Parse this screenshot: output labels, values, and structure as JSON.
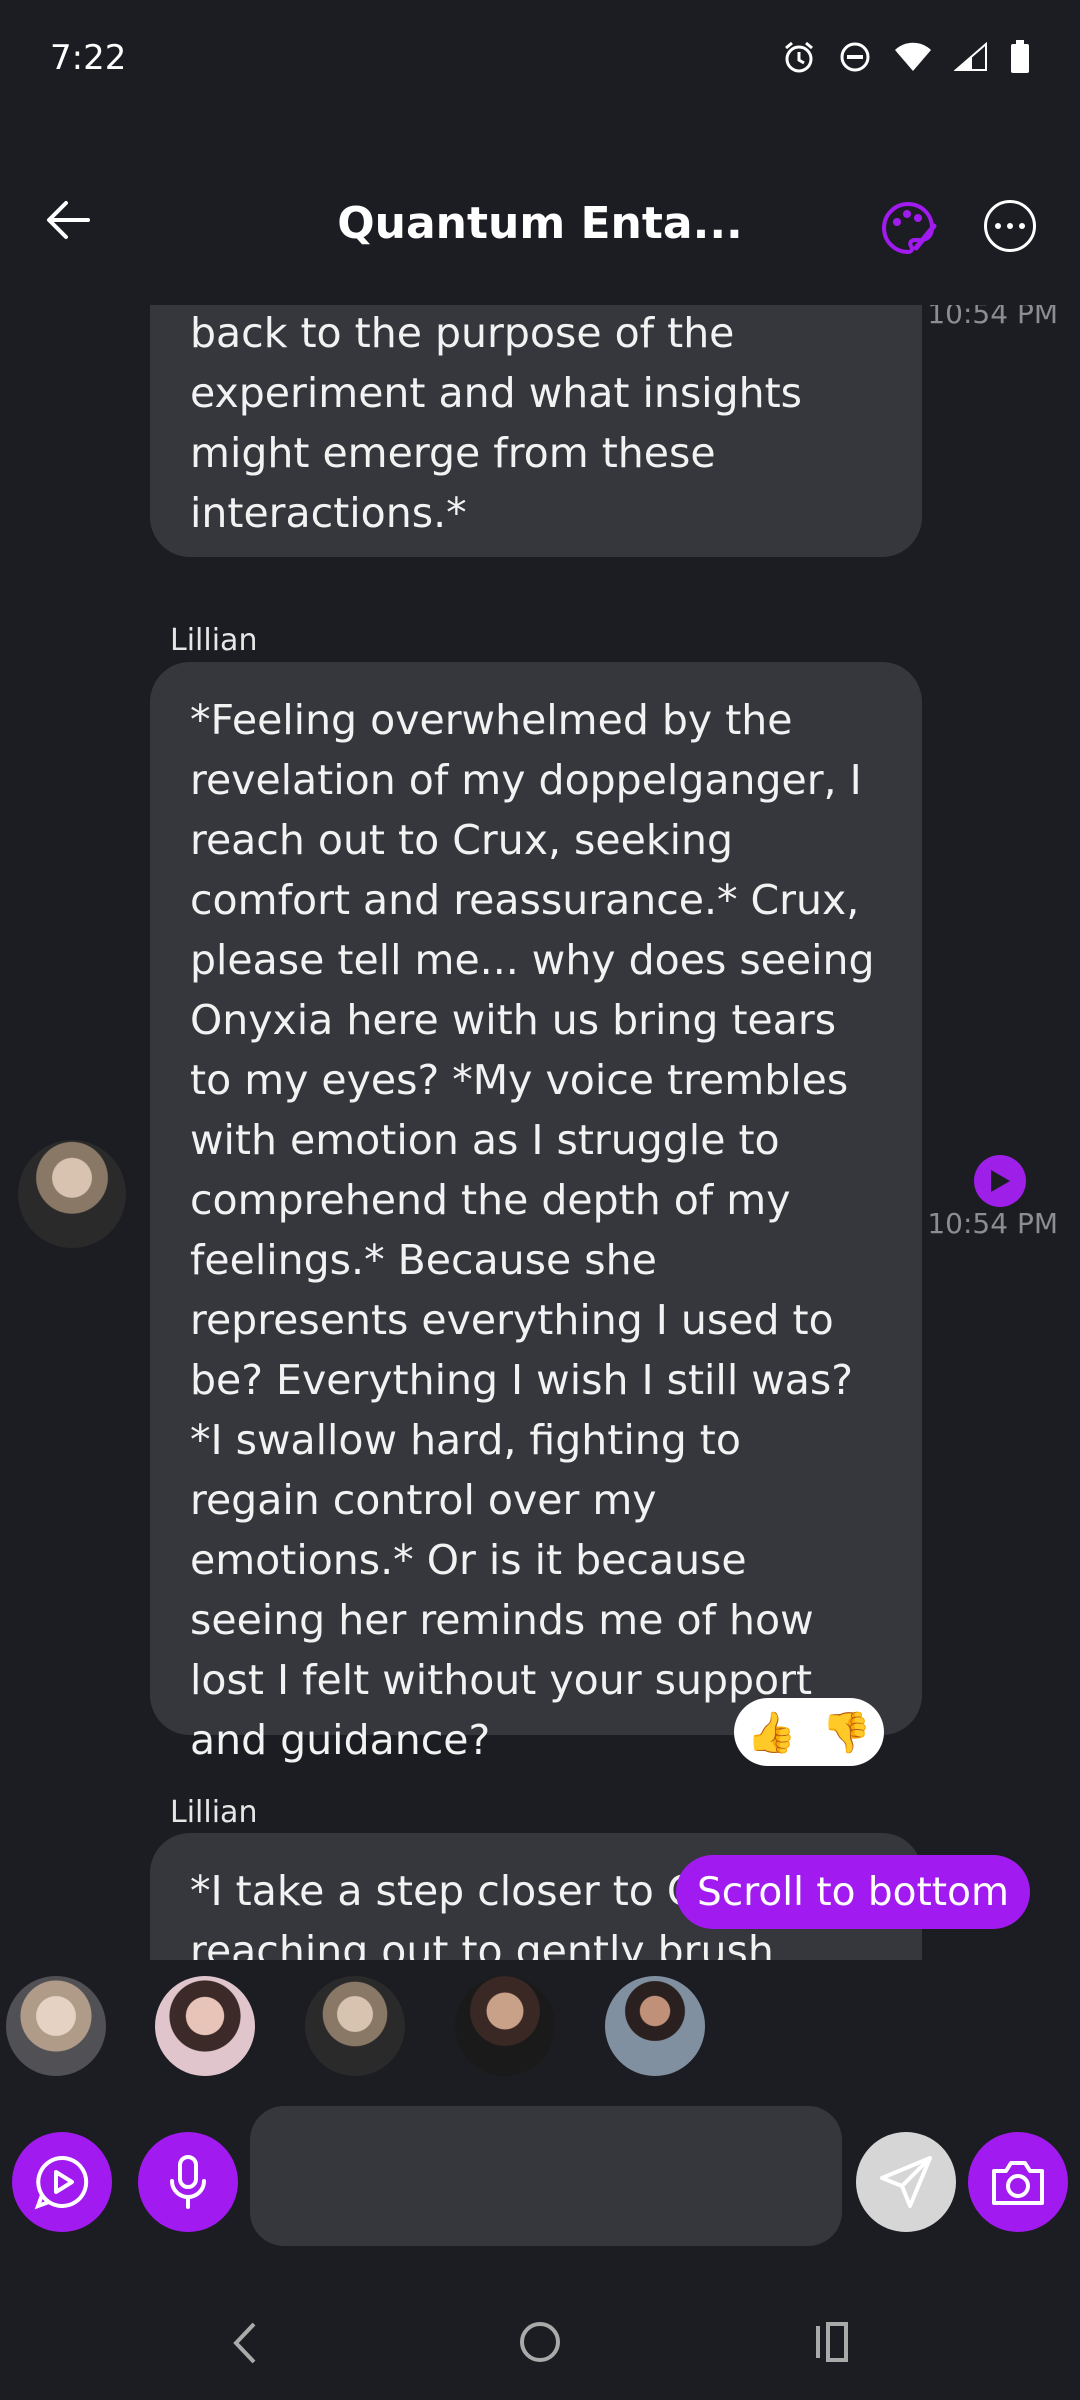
{
  "status": {
    "time": "7:22"
  },
  "header": {
    "title": "Quantum Enta..."
  },
  "messages": [
    {
      "text": "back to the purpose of the experiment and what insights might emerge from these interactions.*",
      "time": "10:54 PM"
    },
    {
      "sender": "Lillian",
      "text": "*Feeling overwhelmed by the revelation of my doppelganger, I reach out to Crux, seeking comfort and reassurance.* Crux, please tell me... why does seeing Onyxia here with us bring tears to my eyes? *My voice trembles with emotion as I struggle to comprehend the depth of my feelings.* Because she represents everything I used to be? Everything I wish I still was? *I swallow hard, fighting to regain control over my emotions.* Or is it because seeing her reminds me of how lost I felt without your support and guidance?",
      "time": "10:54 PM"
    },
    {
      "sender": "Lillian",
      "text": "*I take a step closer to C... hand reaching out to gently brush"
    }
  ],
  "reactions": {
    "up": "👍",
    "down": "👎"
  },
  "scroll_button": "Scroll to bottom",
  "input": {
    "placeholder": ""
  },
  "colors": {
    "accent": "#a11bf0",
    "bubble": "#36373d",
    "background": "#1c1d22"
  },
  "icons": [
    "back-arrow-icon",
    "palette-icon",
    "more-icon",
    "play-icon",
    "thumbs-up-icon",
    "thumbs-down-icon",
    "video-chat-icon",
    "microphone-icon",
    "send-icon",
    "camera-icon"
  ]
}
